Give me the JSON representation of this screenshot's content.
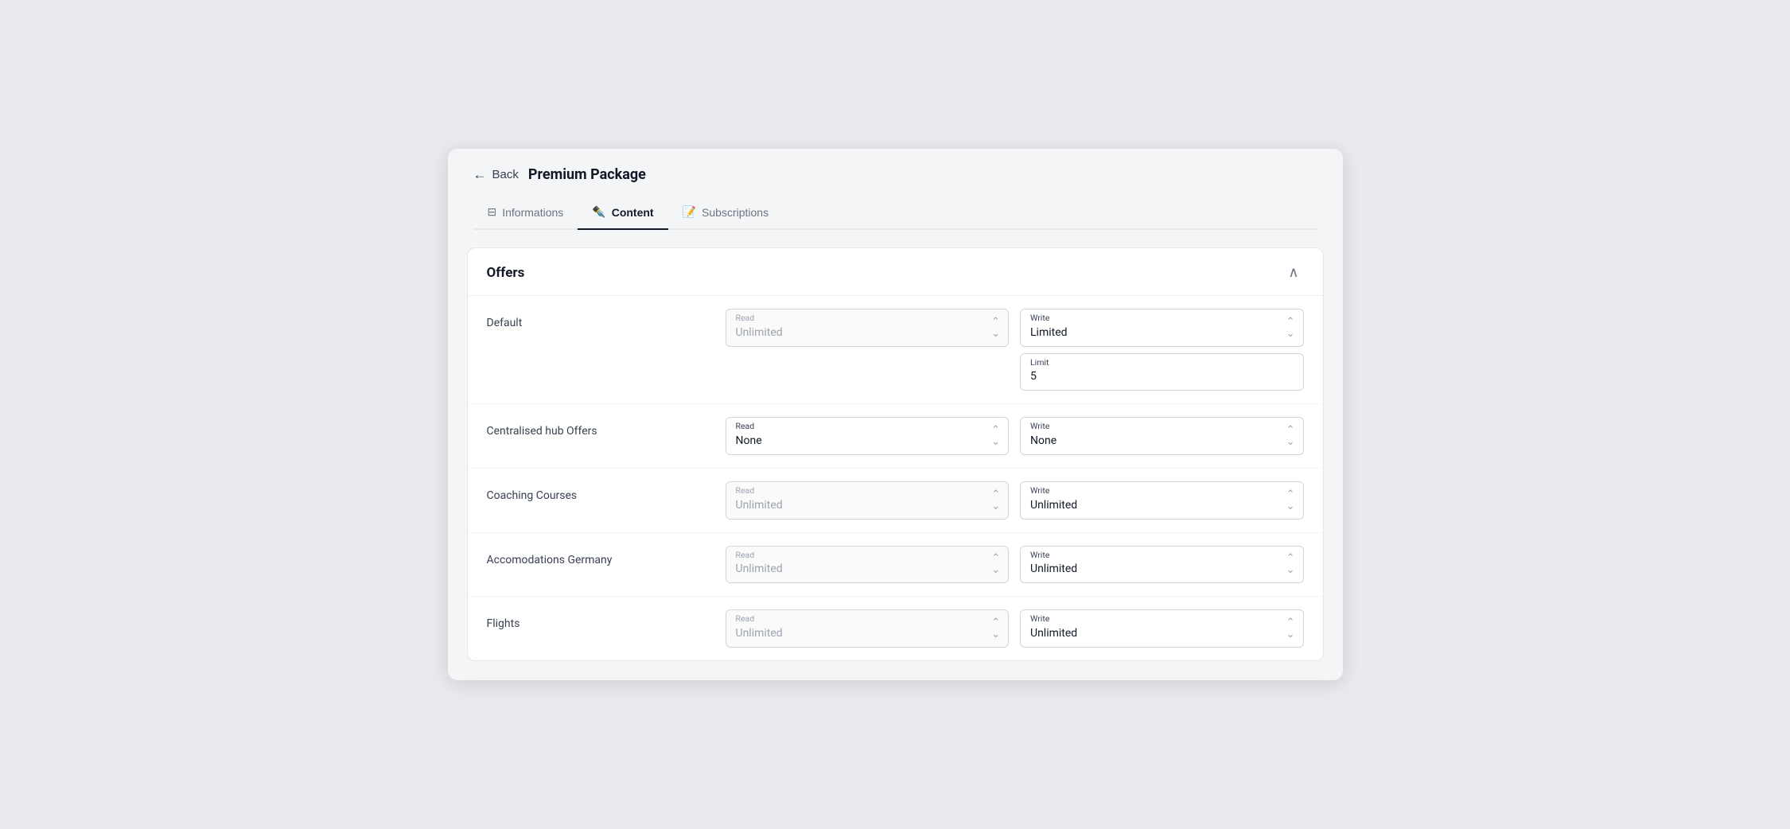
{
  "header": {
    "back_label": "Back",
    "page_title": "Premium Package"
  },
  "tabs": [
    {
      "id": "informations",
      "label": "Informations",
      "icon": "📋",
      "active": false
    },
    {
      "id": "content",
      "label": "Content",
      "icon": "✏️",
      "active": true
    },
    {
      "id": "subscriptions",
      "label": "Subscriptions",
      "icon": "📝",
      "active": false
    }
  ],
  "card": {
    "title": "Offers",
    "collapse_icon": "∧"
  },
  "offers": [
    {
      "id": "default",
      "label": "Default",
      "read": {
        "label": "Read",
        "value": "Unlimited",
        "muted": true
      },
      "write": {
        "label": "Write",
        "value": "Limited",
        "muted": false
      },
      "has_limit": true,
      "limit_label": "Limit",
      "limit_value": "5"
    },
    {
      "id": "centralised",
      "label": "Centralised hub Offers",
      "read": {
        "label": "Read",
        "value": "None",
        "muted": false
      },
      "write": {
        "label": "Write",
        "value": "None",
        "muted": false
      },
      "has_limit": false
    },
    {
      "id": "coaching",
      "label": "Coaching Courses",
      "read": {
        "label": "Read",
        "value": "Unlimited",
        "muted": true
      },
      "write": {
        "label": "Write",
        "value": "Unlimited",
        "muted": false
      },
      "has_limit": false
    },
    {
      "id": "accommodations",
      "label": "Accomodations Germany",
      "read": {
        "label": "Read",
        "value": "Unlimited",
        "muted": true
      },
      "write": {
        "label": "Write",
        "value": "Unlimited",
        "muted": false
      },
      "has_limit": false
    },
    {
      "id": "flights",
      "label": "Flights",
      "read": {
        "label": "Read",
        "value": "Unlimited",
        "muted": true
      },
      "write": {
        "label": "Write",
        "value": "Unlimited",
        "muted": false
      },
      "has_limit": false
    }
  ]
}
